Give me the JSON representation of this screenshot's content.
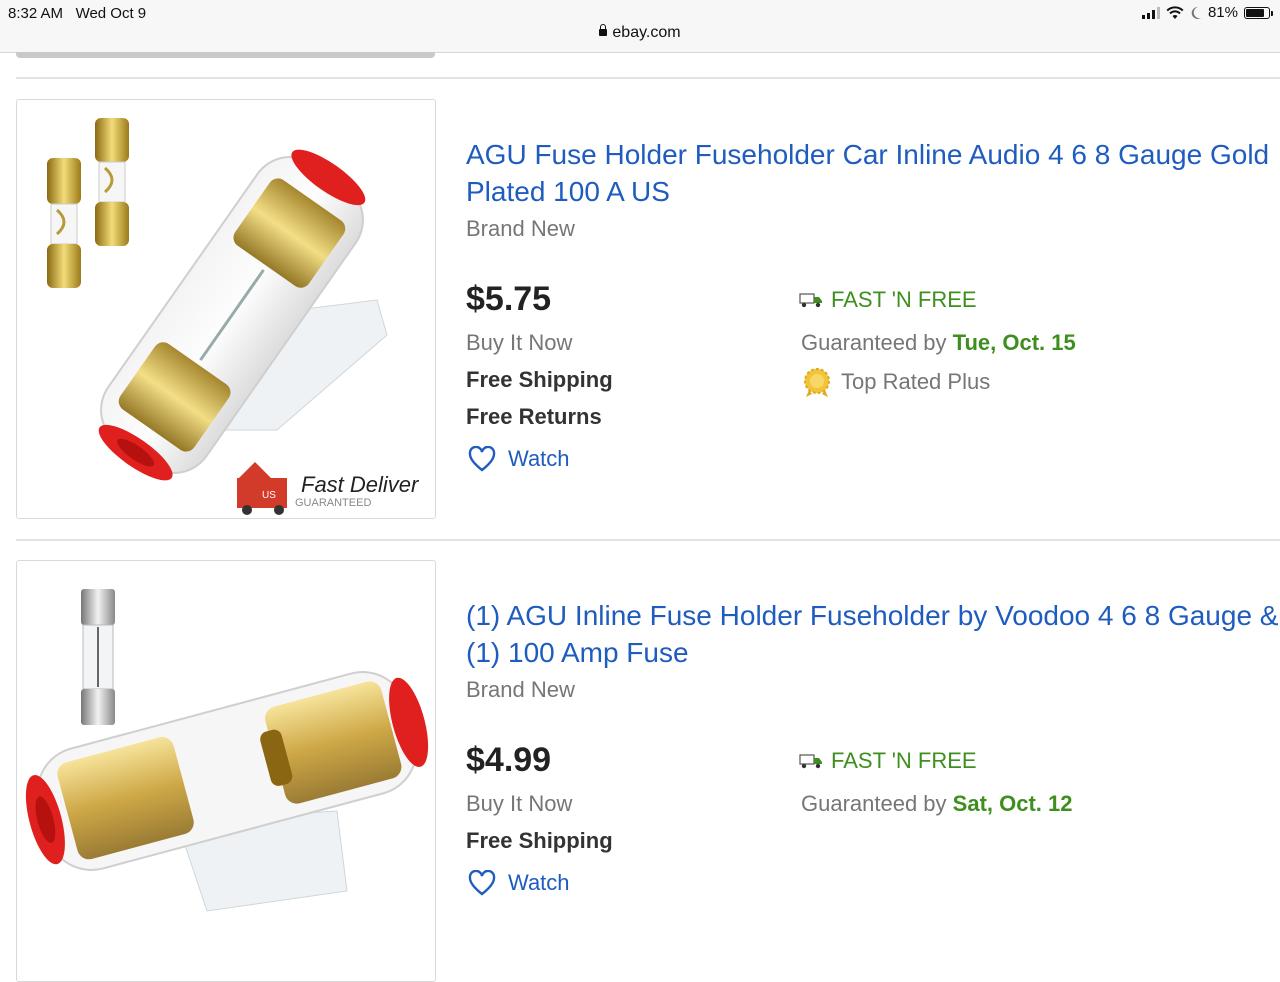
{
  "status_bar": {
    "time": "8:32 AM",
    "date": "Wed Oct 9",
    "battery": "81%",
    "battery_level": 0.81,
    "url": "ebay.com"
  },
  "listings": [
    {
      "title": "AGU Fuse Holder Fuseholder Car Inline Audio 4 6 8 Gauge Gold Plated 100 A US",
      "condition": "Brand New",
      "price": "$5.75",
      "format": "Buy It Now",
      "shipping": "Free Shipping",
      "returns": "Free Returns",
      "watch_label": "Watch",
      "fast_label": "FAST 'N FREE",
      "guaranteed_prefix": "Guaranteed by",
      "guaranteed_date": "Tue, Oct. 15",
      "top_rated": "Top Rated Plus",
      "badge_text": "Fast Deliver",
      "badge_sub": "GUARANTEED",
      "badge_truck_text": "US"
    },
    {
      "title": "(1) AGU Inline Fuse Holder Fuseholder by Voodoo 4 6 8 Gauge & (1) 100 Amp Fuse",
      "condition": "Brand New",
      "price": "$4.99",
      "format": "Buy It Now",
      "shipping": "Free Shipping",
      "watch_label": "Watch",
      "fast_label": "FAST 'N FREE",
      "guaranteed_prefix": "Guaranteed by",
      "guaranteed_date": "Sat, Oct. 12"
    }
  ],
  "colors": {
    "link": "#1f5cbf",
    "green": "#3f8f1e",
    "muted": "#767676"
  }
}
